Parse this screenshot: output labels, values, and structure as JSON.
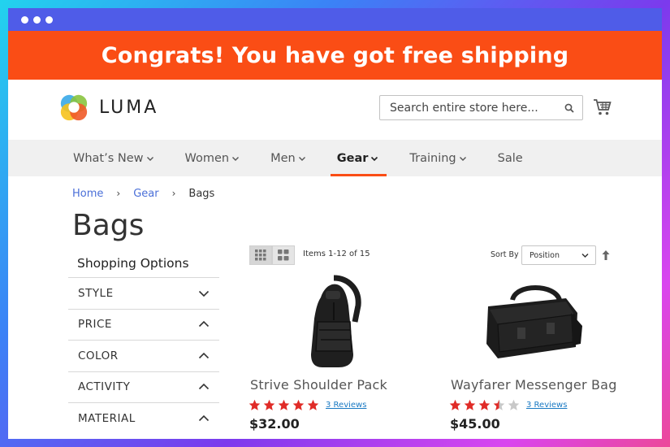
{
  "promo": {
    "text": "Congrats! You have got free shipping"
  },
  "header": {
    "logo_text": "LUMA",
    "search_placeholder": "Search entire store here..."
  },
  "nav": {
    "items": [
      {
        "label": "What’s New",
        "has_menu": true
      },
      {
        "label": "Women",
        "has_menu": true
      },
      {
        "label": "Men",
        "has_menu": true
      },
      {
        "label": "Gear",
        "has_menu": true,
        "active": true
      },
      {
        "label": "Training",
        "has_menu": true
      },
      {
        "label": "Sale",
        "has_menu": false
      }
    ]
  },
  "breadcrumb": [
    "Home",
    "Gear",
    "Bags"
  ],
  "page_title": "Bags",
  "sidebar": {
    "title": "Shopping Options",
    "filters": [
      {
        "label": "STYLE",
        "icon": "chevron-down-icon"
      },
      {
        "label": "PRICE",
        "icon": "chevron-up-icon"
      },
      {
        "label": "COLOR",
        "icon": "chevron-up-icon"
      },
      {
        "label": "ACTIVITY",
        "icon": "chevron-up-icon"
      },
      {
        "label": "MATERIAL",
        "icon": "chevron-up-icon"
      }
    ]
  },
  "toolbar": {
    "items_count": "Items 1-12 of 15",
    "sort_label": "Sort By",
    "sort_value": "Position"
  },
  "products": [
    {
      "name": "Strive Shoulder Pack",
      "rating": 5,
      "reviews": "3 Reviews",
      "price": "$32.00"
    },
    {
      "name": "Wayfarer Messenger Bag",
      "rating": 3.5,
      "reviews": "3 Reviews",
      "price": "$45.00"
    }
  ],
  "colors": {
    "accent": "#fa4d15",
    "titlebar": "#4f5ce8",
    "star": "#e02b27",
    "link": "#1979c3"
  }
}
